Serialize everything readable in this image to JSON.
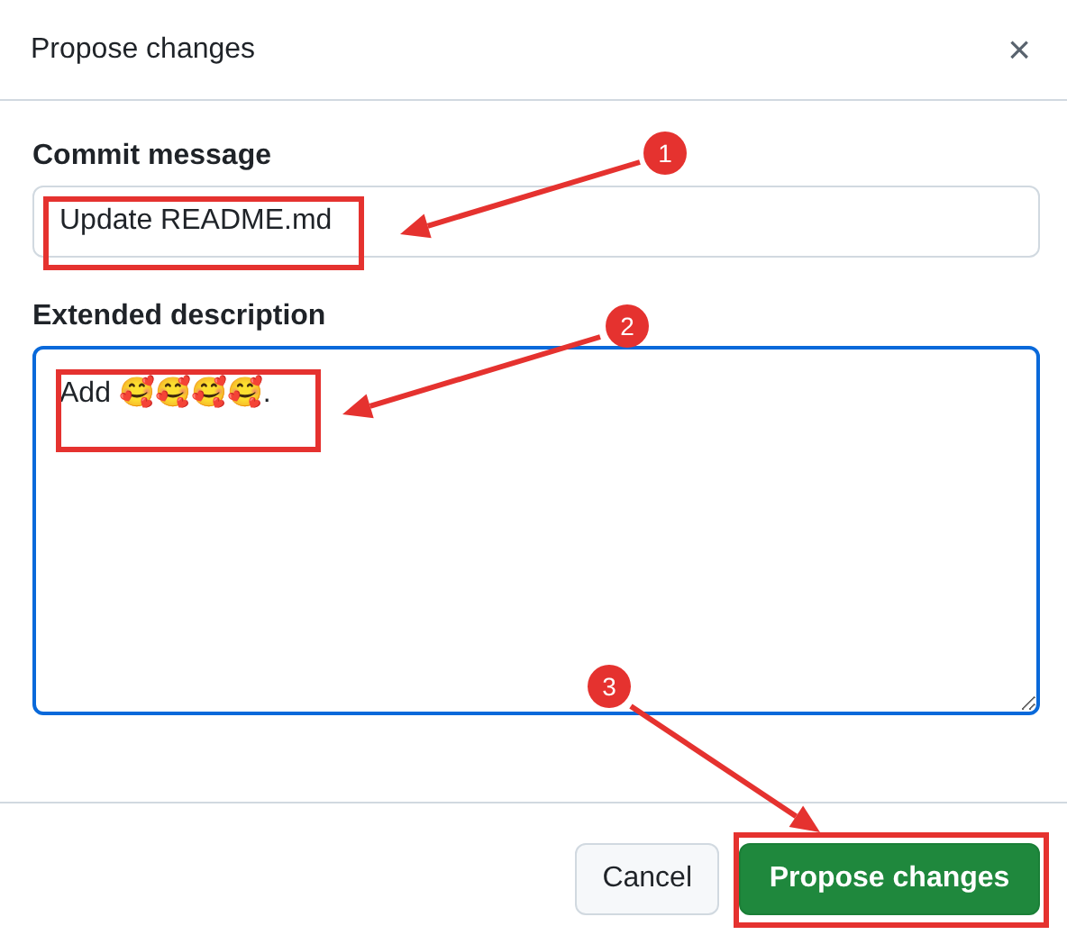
{
  "dialog": {
    "title": "Propose changes",
    "close": "×"
  },
  "fields": [
    {
      "kind": "input",
      "label": "Commit message",
      "value": "Update README.md"
    },
    {
      "kind": "textarea",
      "label": "Extended description",
      "value": "Add 🥰🥰🥰🥰.",
      "focused": true
    }
  ],
  "buttons": [
    {
      "label": "Cancel",
      "kind": "default"
    },
    {
      "label": "Propose changes",
      "kind": "primary"
    }
  ],
  "annotations": [
    {
      "number": "1"
    },
    {
      "number": "2"
    },
    {
      "number": "3"
    }
  ]
}
